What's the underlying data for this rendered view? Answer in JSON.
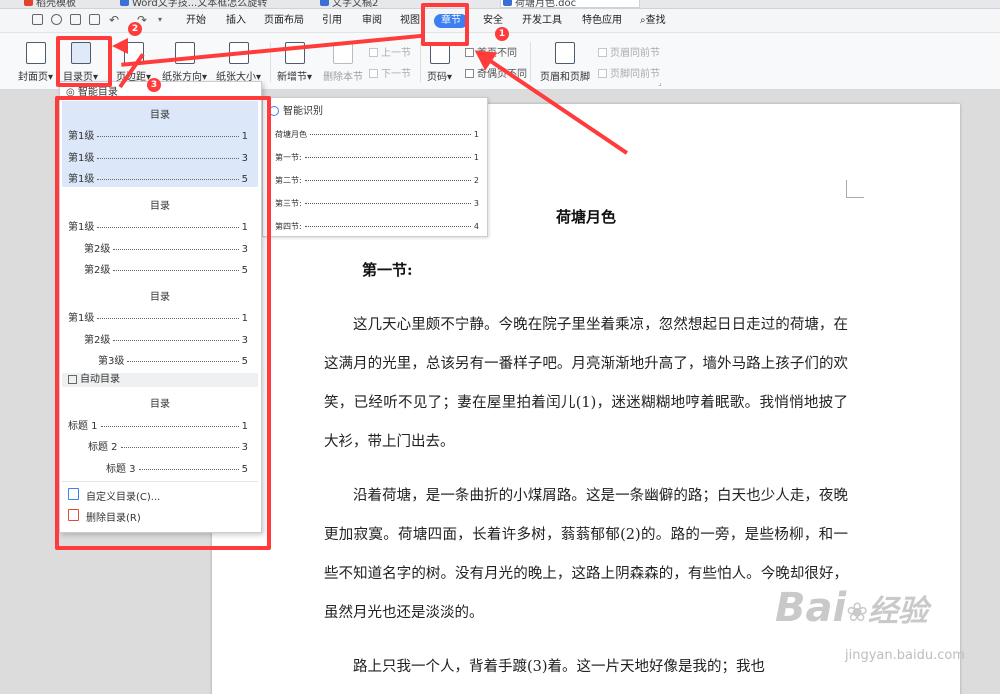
{
  "tabs": [
    {
      "label": "稻壳模板",
      "kind": "wps"
    },
    {
      "label": "Word文字技...文本框怎么旋转",
      "kind": "doc"
    },
    {
      "label": "文字文稿2",
      "kind": "doc"
    },
    {
      "label": "荷塘月色.doc",
      "kind": "doc"
    }
  ],
  "menu": {
    "items": [
      "开始",
      "插入",
      "页面布局",
      "引用",
      "审阅",
      "视图",
      "章节",
      "安全",
      "开发工具",
      "特色应用"
    ],
    "active": "章节",
    "search": "查找"
  },
  "ribbon": {
    "cover": "封面页",
    "toc": "目录页",
    "margin": "页边距",
    "orientation": "纸张方向",
    "size": "纸张大小",
    "new_section": "新增节",
    "delete_section": "删除本节",
    "prev_section": "上一节",
    "next_section": "下一节",
    "page_number": "页码",
    "diff_first": "首页不同",
    "odd_even": "奇偶页不同",
    "header_footer": "页眉和页脚",
    "header_same": "页眉同前节",
    "footer_same": "页脚同前节"
  },
  "dropdown": {
    "smart_toc": "智能目录",
    "toc_title": "目录",
    "group1": [
      {
        "label": "第1级",
        "page": "1"
      },
      {
        "label": "第1级",
        "page": "3"
      },
      {
        "label": "第1级",
        "page": "5"
      }
    ],
    "group2": [
      {
        "label": "第1级",
        "page": "1"
      },
      {
        "label": "第2级",
        "page": "3"
      },
      {
        "label": "第2级",
        "page": "5"
      }
    ],
    "group3": [
      {
        "label": "第1级",
        "page": "1"
      },
      {
        "label": "第2级",
        "page": "3"
      },
      {
        "label": "第3级",
        "page": "5"
      }
    ],
    "auto_toc": "自动目录",
    "group4": [
      {
        "label": "标题 1",
        "page": "1"
      },
      {
        "label": "标题 2",
        "page": "3"
      },
      {
        "label": "标题 3",
        "page": "5"
      }
    ],
    "custom": "自定义目录(C)...",
    "delete": "删除目录(R)"
  },
  "smart_panel": {
    "header": "智能识别",
    "rows": [
      {
        "label": "荷塘月色",
        "page": "1"
      },
      {
        "label": "第一节:",
        "page": "1"
      },
      {
        "label": "第二节:",
        "page": "2"
      },
      {
        "label": "第三节:",
        "page": "3"
      },
      {
        "label": "第四节:",
        "page": "4"
      }
    ]
  },
  "document": {
    "title": "荷塘月色",
    "heading": "第一节:",
    "paragraphs": [
      "这几天心里颇不宁静。今晚在院子里坐着乘凉，忽然想起日日走过的荷塘，在这满月的光里，总该另有一番样子吧。月亮渐渐地升高了，墙外马路上孩子们的欢笑，已经听不见了；妻在屋里拍着闰儿(1)，迷迷糊糊地哼着眠歌。我悄悄地披了大衫，带上门出去。",
      "沿着荷塘，是一条曲折的小煤屑路。这是一条幽僻的路；白天也少人走，夜晚更加寂寞。荷塘四面，长着许多树，蓊蓊郁郁(2)的。路的一旁，是些杨柳，和一些不知道名字的树。没有月光的晚上，这路上阴森森的，有些怕人。今晚却很好，虽然月光也还是淡淡的。",
      "路上只我一个人，背着手踱(3)着。这一片天地好像是我的；我也"
    ]
  },
  "annotations": {
    "step1": "1",
    "step2": "2",
    "step3": "3"
  },
  "watermark": {
    "brand": "Bai",
    "brand2": "经验",
    "url": "jingyan.baidu.com"
  }
}
